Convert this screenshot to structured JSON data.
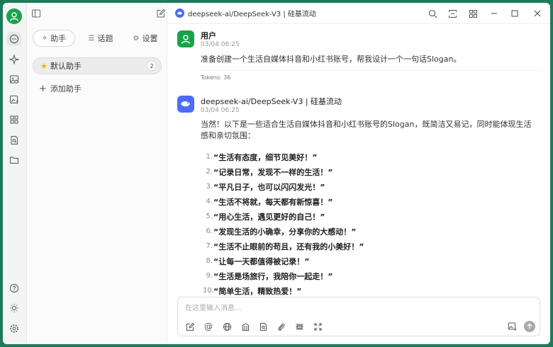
{
  "window": {
    "title": "deepseek-ai/DeepSeek-V3 | 硅基流动"
  },
  "sidebar": {
    "tabs": [
      {
        "label": "助手",
        "icon": "sparkle-icon"
      },
      {
        "label": "话题",
        "icon": "list-icon"
      },
      {
        "label": "设置",
        "icon": "gear-icon"
      }
    ],
    "assistants": [
      {
        "label": "默认助手",
        "icon": "star-emoji",
        "count": "2"
      }
    ],
    "add_label": "添加助手"
  },
  "messages": [
    {
      "sender": "用户",
      "time": "03/04 06:25",
      "text": "准备创建一个生活自媒体抖音和小红书账号，帮我设计一个一句话Slogan。",
      "tokens": "Tokens: 36"
    },
    {
      "sender": "deepseek-ai/DeepSeek-V3 | 硅基流动",
      "time": "03/04 06:25",
      "intro": "当然！以下是一些适合生活自媒体抖音和小红书账号的Slogan，既简洁又易记，同时能体现生活感和亲切氛围：",
      "items": [
        "“生活有态度，细节见美好！”",
        "“记录日常，发现不一样的生活！”",
        "“平凡日子，也可以闪闪发光！”",
        "“生活不将就，每天都有新惊喜！”",
        "“用心生活，遇见更好的自己！”",
        "“发现生活的小确幸，分享你的大感动！”",
        "“生活不止眼前的苟且，还有我的小美好！”",
        "“让每一天都值得被记录！”",
        "“生活是场旅行，我陪你一起走！”",
        "“简单生活，精致热爱！”"
      ]
    }
  ],
  "input": {
    "placeholder": "在这里输入消息..."
  },
  "colors": {
    "frame": "#1f7a5c",
    "avatar_green": "#17a34a",
    "assistant_avatar": "#4d6bfe"
  }
}
